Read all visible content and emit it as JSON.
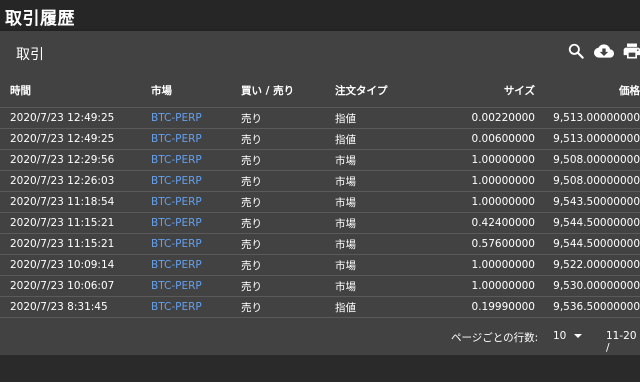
{
  "page": {
    "title": "取引履歴"
  },
  "card": {
    "title": "取引",
    "icons": [
      "search-icon",
      "cloud-download-icon",
      "print-icon"
    ]
  },
  "table": {
    "headers": {
      "time": "時間",
      "market": "市場",
      "side": "買い / 売り",
      "order_type": "注文タイプ",
      "size": "サイズ",
      "price": "価格"
    },
    "rows": [
      {
        "time": "2020/7/23 12:49:25",
        "market": "BTC-PERP",
        "side": "売り",
        "order_type": "指値",
        "size": "0.00220000",
        "price": "9,513.00000000"
      },
      {
        "time": "2020/7/23 12:49:25",
        "market": "BTC-PERP",
        "side": "売り",
        "order_type": "指値",
        "size": "0.00600000",
        "price": "9,513.00000000"
      },
      {
        "time": "2020/7/23 12:29:56",
        "market": "BTC-PERP",
        "side": "売り",
        "order_type": "市場",
        "size": "1.00000000",
        "price": "9,508.00000000"
      },
      {
        "time": "2020/7/23 12:26:03",
        "market": "BTC-PERP",
        "side": "売り",
        "order_type": "市場",
        "size": "1.00000000",
        "price": "9,508.00000000"
      },
      {
        "time": "2020/7/23 11:18:54",
        "market": "BTC-PERP",
        "side": "売り",
        "order_type": "市場",
        "size": "1.00000000",
        "price": "9,543.50000000"
      },
      {
        "time": "2020/7/23 11:15:21",
        "market": "BTC-PERP",
        "side": "売り",
        "order_type": "市場",
        "size": "0.42400000",
        "price": "9,544.50000000"
      },
      {
        "time": "2020/7/23 11:15:21",
        "market": "BTC-PERP",
        "side": "売り",
        "order_type": "市場",
        "size": "0.57600000",
        "price": "9,544.50000000"
      },
      {
        "time": "2020/7/23 10:09:14",
        "market": "BTC-PERP",
        "side": "売り",
        "order_type": "市場",
        "size": "1.00000000",
        "price": "9,522.00000000"
      },
      {
        "time": "2020/7/23 10:06:07",
        "market": "BTC-PERP",
        "side": "売り",
        "order_type": "市場",
        "size": "1.00000000",
        "price": "9,530.00000000"
      },
      {
        "time": "2020/7/23 8:31:45",
        "market": "BTC-PERP",
        "side": "売り",
        "order_type": "指値",
        "size": "0.19990000",
        "price": "9,536.50000000"
      }
    ]
  },
  "pagination": {
    "rows_per_page_label": "ページごとの行数:",
    "rows_per_page": "10",
    "range": "11-20 /"
  },
  "colors": {
    "background": "#2a2a2a",
    "card": "#424242",
    "link": "#64a0ec",
    "text": "#ffffff"
  }
}
